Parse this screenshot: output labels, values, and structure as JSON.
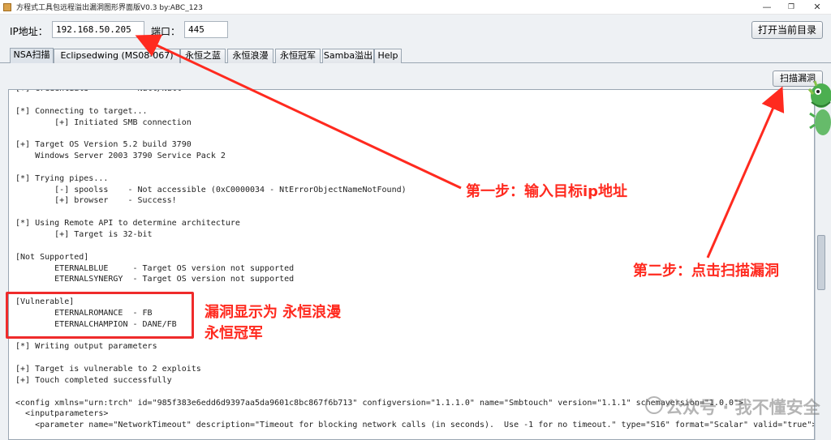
{
  "window": {
    "title": "方程式工具包远程溢出漏洞图形界面版V0.3 by:ABC_123",
    "minimize": "—",
    "maximize": "❐",
    "close": "✕"
  },
  "toolbar": {
    "ip_label": "IP地址：",
    "ip_value": "192.168.50.205",
    "port_label": "端口：",
    "port_value": "445",
    "open_dir_label": "打开当前目录"
  },
  "tabs": [
    {
      "label": "NSA扫描",
      "active": true
    },
    {
      "label": "Eclipsedwing (MS08-067)",
      "active": false
    },
    {
      "label": "永恒之蓝",
      "active": false
    },
    {
      "label": "永恒浪漫",
      "active": false
    },
    {
      "label": "永恒冠军",
      "active": false
    },
    {
      "label": "Samba溢出",
      "active": false
    },
    {
      "label": "Help",
      "active": false
    }
  ],
  "scan_button": "扫描漏洞",
  "output_lines": [
    "[+] Credentials          Null/Null",
    "",
    "[*] Connecting to target...",
    "        [+] Initiated SMB connection",
    "",
    "[+] Target OS Version 5.2 build 3790",
    "    Windows Server 2003 3790 Service Pack 2",
    "",
    "[*] Trying pipes...",
    "        [-] spoolss    - Not accessible (0xC0000034 - NtErrorObjectNameNotFound)",
    "        [+] browser    - Success!",
    "",
    "[*] Using Remote API to determine architecture",
    "        [+] Target is 32-bit",
    "",
    "[Not Supported]",
    "        ETERNALBLUE     - Target OS version not supported",
    "        ETERNALSYNERGY  - Target OS version not supported",
    "",
    "[Vulnerable]",
    "        ETERNALROMANCE  - FB",
    "        ETERNALCHAMPION - DANE/FB",
    "",
    "[*] Writing output parameters",
    "",
    "[+] Target is vulnerable to 2 exploits",
    "[+] Touch completed successfully",
    "",
    "<config xmlns=\"urn:trch\" id=\"985f383e6edd6d9397aa5da9601c8bc867f6b713\" configversion=\"1.1.1.0\" name=\"Smbtouch\" version=\"1.1.1\" schemaversion=\"1.0.0\">",
    "  <inputparameters>",
    "    <parameter name=\"NetworkTimeout\" description=\"Timeout for blocking network calls (in seconds).  Use -1 for no timeout.\" type=\"S16\" format=\"Scalar\" valid=\"true\">"
  ],
  "annotations": {
    "step1": "第一步：输入目标ip地址",
    "step2": "第二步：点击扫描漏洞",
    "vuln_line1": "漏洞显示为 永恒浪漫",
    "vuln_line2": "永恒冠军"
  },
  "watermark": "公众号 · 我不懂安全",
  "colors": {
    "annotation_red": "#ff2a1f",
    "panel_bg": "#eef1f4"
  }
}
